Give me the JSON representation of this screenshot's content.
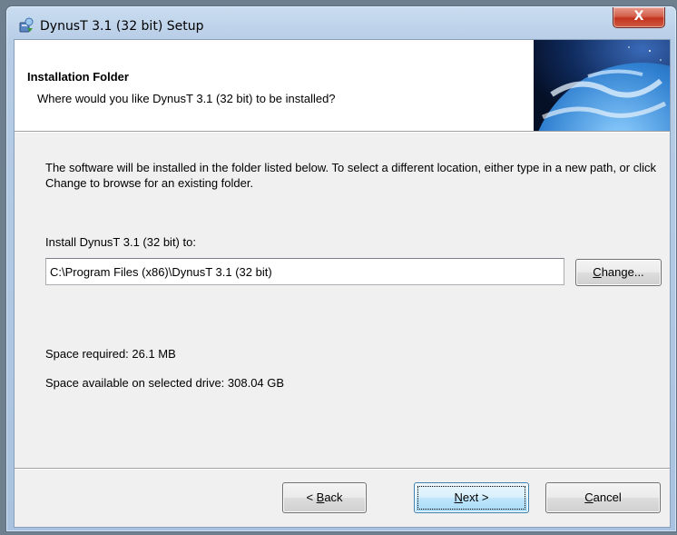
{
  "window": {
    "title": "DynusT 3.1 (32 bit) Setup",
    "close_glyph": "X"
  },
  "header": {
    "title": "Installation Folder",
    "subtitle": "Where would you like DynusT 3.1 (32 bit) to be installed?",
    "banner_icon": "earth-globe-image"
  },
  "body": {
    "description": "The software will be installed in the folder listed below. To select a different location, either type in a new path, or click Change to browse for an existing folder.",
    "install_label": "Install DynusT 3.1 (32 bit) to:",
    "install_path": "C:\\Program Files (x86)\\DynusT 3.1 (32 bit)",
    "change_button": {
      "mnemonic": "C",
      "rest": "hange..."
    },
    "space_required": "Space required: 26.1 MB",
    "space_available": "Space available on selected drive: 308.04 GB"
  },
  "footer": {
    "back_button": {
      "prefix": "< ",
      "mnemonic": "B",
      "rest": "ack"
    },
    "next_button": {
      "mnemonic": "N",
      "rest": "ext >"
    },
    "cancel_button": {
      "mnemonic": "C",
      "rest": "ancel"
    }
  },
  "colors": {
    "title_bar": "#b7cde6",
    "close_button": "#c2331f",
    "dialog_background": "#f0f0f0",
    "default_button_border": "#3c7fb1"
  }
}
